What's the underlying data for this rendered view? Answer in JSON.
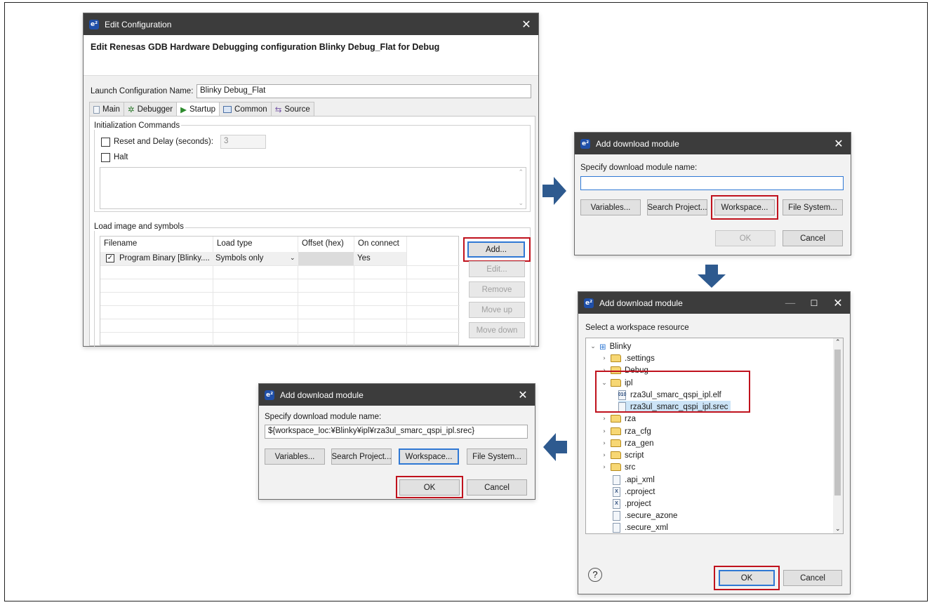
{
  "edit_config": {
    "title": "Edit Configuration",
    "heading": "Edit Renesas GDB Hardware Debugging configuration Blinky Debug_Flat for Debug",
    "launch_name_label": "Launch Configuration Name:",
    "launch_name_value": "Blinky Debug_Flat",
    "tabs": [
      "Main",
      "Debugger",
      "Startup",
      "Common",
      "Source"
    ],
    "init_group": "Initialization Commands",
    "reset_label": "Reset and Delay (seconds):",
    "reset_value": "3",
    "halt_label": "Halt",
    "load_group": "Load image and symbols",
    "columns": [
      "Filename",
      "Load type",
      "Offset (hex)",
      "On connect"
    ],
    "row": {
      "filename": "Program Binary [Blinky....",
      "load_type": "Symbols only",
      "offset": "",
      "on_connect": "Yes"
    },
    "buttons": {
      "add": "Add...",
      "edit": "Edit...",
      "remove": "Remove",
      "move_up": "Move up",
      "move_down": "Move down"
    }
  },
  "dlg1": {
    "title": "Add download module",
    "prompt": "Specify download module name:",
    "value": "",
    "buttons": {
      "variables": "Variables...",
      "search_project": "Search Project...",
      "workspace": "Workspace...",
      "file_system": "File System...",
      "ok": "OK",
      "cancel": "Cancel"
    }
  },
  "dlg2": {
    "title": "Add download module",
    "prompt": "Select a workspace resource",
    "tree": {
      "root": "Blinky",
      "settings": ".settings",
      "debug": "Debug",
      "ipl": "ipl",
      "elf": "rza3ul_smarc_qspi_ipl.elf",
      "srec": "rza3ul_smarc_qspi_ipl.srec",
      "rza": "rza",
      "rza_cfg": "rza_cfg",
      "rza_gen": "rza_gen",
      "script": "script",
      "src": "src",
      "api_xml": ".api_xml",
      "cproject": ".cproject",
      "project": ".project",
      "secure_azone": ".secure_azone",
      "secure_xml": ".secure_xml"
    },
    "help_icon": "?",
    "buttons": {
      "ok": "OK",
      "cancel": "Cancel"
    }
  },
  "dlg3": {
    "title": "Add download module",
    "prompt": "Specify download module name:",
    "value": "${workspace_loc:¥Blinky¥ipl¥rza3ul_smarc_qspi_ipl.srec}",
    "buttons": {
      "variables": "Variables...",
      "search_project": "Search Project...",
      "workspace": "Workspace...",
      "file_system": "File System...",
      "ok": "OK",
      "cancel": "Cancel"
    }
  },
  "colors": {
    "highlight": "#c0121d",
    "arrow": "#2e5a8f",
    "titlebar": "#3c3c3c",
    "focus": "#2f78d4"
  }
}
